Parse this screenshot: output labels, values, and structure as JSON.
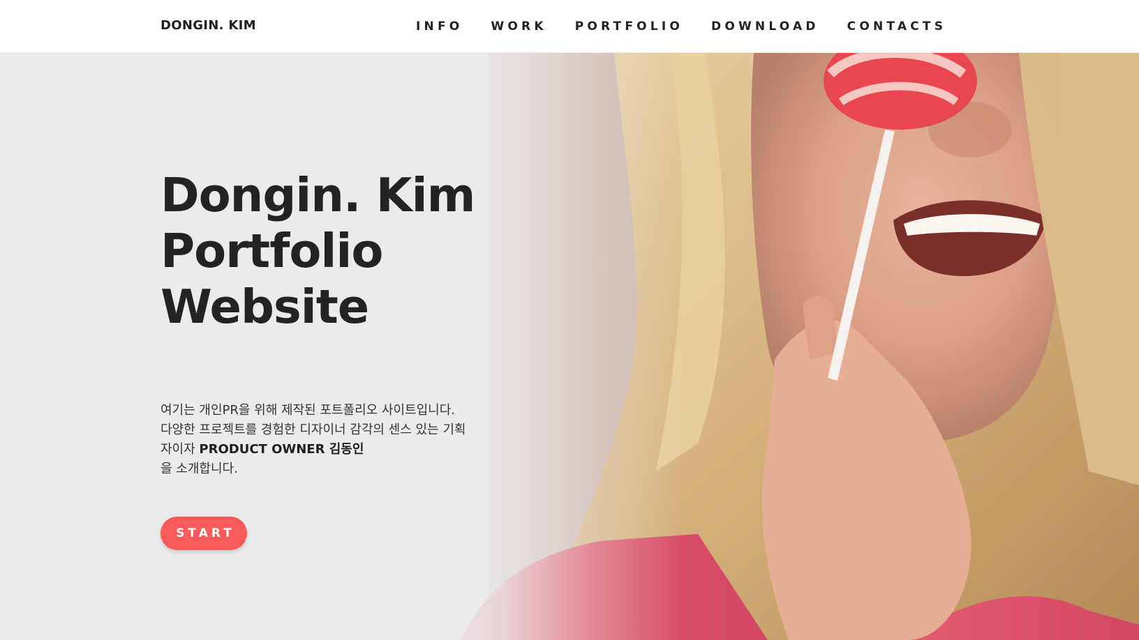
{
  "header": {
    "logo": "DONGIN. KIM",
    "nav": [
      "INFO",
      "WORK",
      "PORTFOLIO",
      "DOWNLOAD",
      "CONTACTS"
    ]
  },
  "hero": {
    "title_lines": [
      "Dongin. Kim",
      "Portfolio",
      "Website"
    ],
    "description": {
      "line1": "여기는 개인PR을 위해 제작된 포트폴리오 사이트입니다. 다양한 프로젝트를 경험한 디자이너 감각의 센스 있는 기획자이자",
      "bold": "PRODUCT OWNER 김동인",
      "line2": "을 소개합니다."
    },
    "start_button": "START"
  },
  "colors": {
    "accent": "#f95b5b",
    "text_dark": "#232323",
    "header_bg": "#ffffff",
    "hero_bg": "#ebe9ea"
  },
  "icons": []
}
